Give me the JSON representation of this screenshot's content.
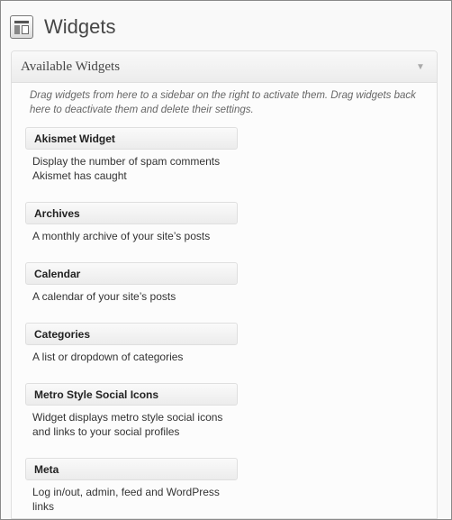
{
  "page": {
    "title": "Widgets",
    "icon": "widgets-icon"
  },
  "panel": {
    "title": "Available Widgets",
    "toggle_icon": "arrow-down-icon",
    "description": "Drag widgets from here to a sidebar on the right to activate them. Drag widgets back here to deactivate them and delete their settings."
  },
  "widgets": [
    {
      "title": "Akismet Widget",
      "description": "Display the number of spam comments Akismet has caught"
    },
    {
      "title": "Archives",
      "description": "A monthly archive of your site’s posts"
    },
    {
      "title": "Calendar",
      "description": "A calendar of your site’s posts"
    },
    {
      "title": "Categories",
      "description": "A list or dropdown of categories"
    },
    {
      "title": "Metro Style Social Icons",
      "description": "Widget displays metro style social icons and links to your social profiles"
    },
    {
      "title": "Meta",
      "description": "Log in/out, admin, feed and WordPress links"
    }
  ]
}
